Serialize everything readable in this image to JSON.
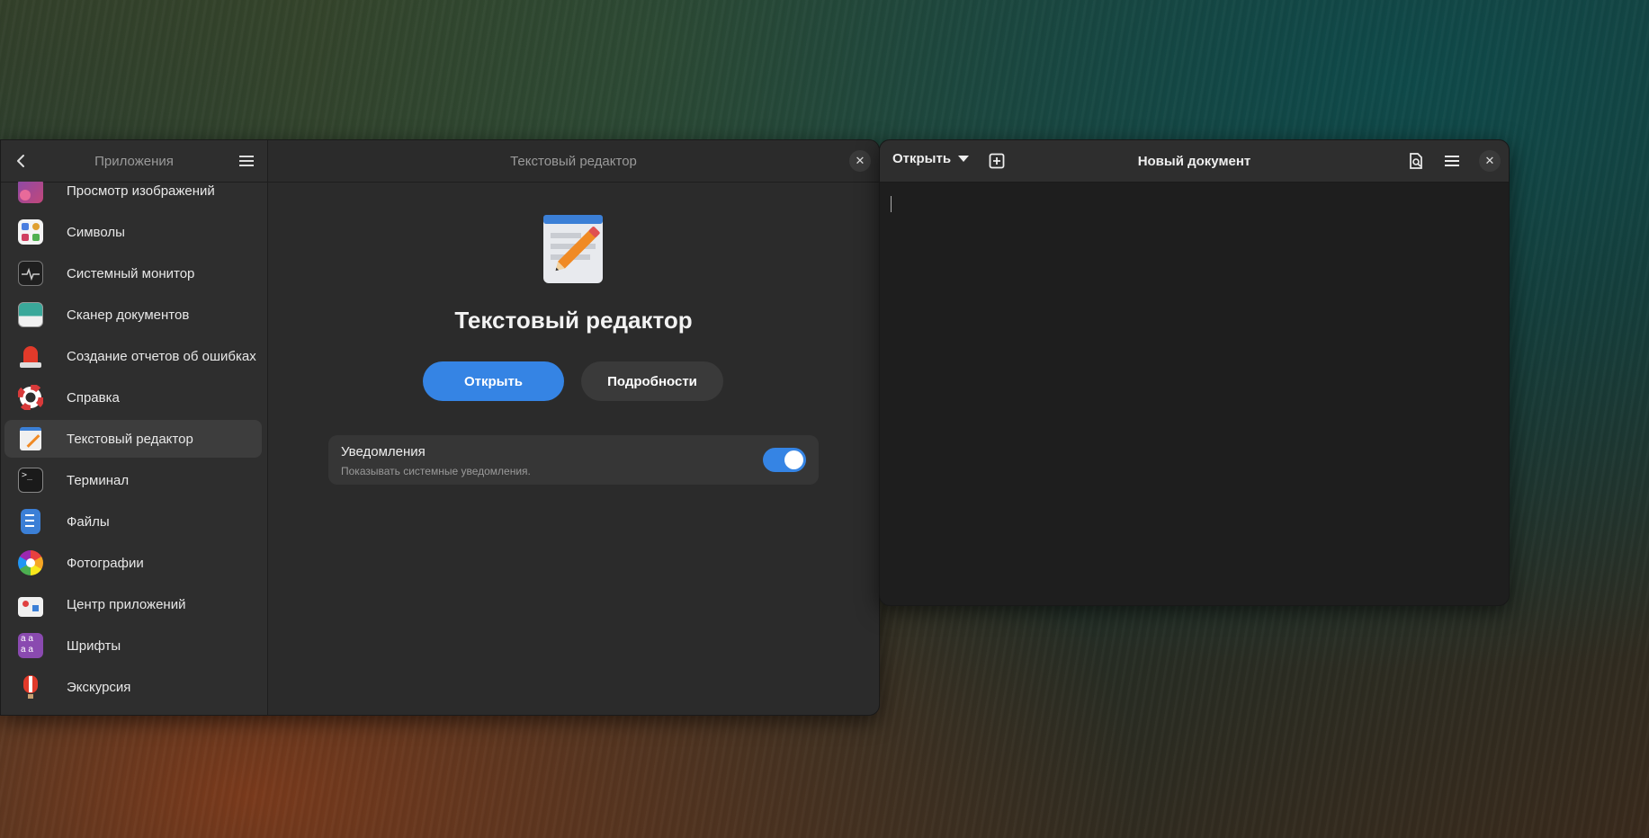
{
  "settings_window": {
    "sidebar": {
      "title": "Приложения",
      "items": [
        {
          "label": "Просмотр изображений",
          "icon": "image-viewer-icon"
        },
        {
          "label": "Символы",
          "icon": "characters-icon"
        },
        {
          "label": "Системный монитор",
          "icon": "system-monitor-icon"
        },
        {
          "label": "Сканер документов",
          "icon": "document-scanner-icon"
        },
        {
          "label": "Создание отчетов об ошибках",
          "icon": "bug-report-icon"
        },
        {
          "label": "Справка",
          "icon": "help-icon"
        },
        {
          "label": "Текстовый редактор",
          "icon": "text-editor-icon",
          "active": true
        },
        {
          "label": "Терминал",
          "icon": "terminal-icon"
        },
        {
          "label": "Файлы",
          "icon": "files-icon"
        },
        {
          "label": "Фотографии",
          "icon": "photos-icon"
        },
        {
          "label": "Центр приложений",
          "icon": "software-center-icon"
        },
        {
          "label": "Шрифты",
          "icon": "fonts-icon"
        },
        {
          "label": "Экскурсия",
          "icon": "tour-icon"
        }
      ]
    },
    "content": {
      "header_title": "Текстовый редактор",
      "app_name": "Текстовый редактор",
      "open_label": "Открыть",
      "details_label": "Подробности",
      "notifications": {
        "title": "Уведомления",
        "subtitle": "Показывать системные уведомления.",
        "enabled": true
      }
    }
  },
  "editor_window": {
    "open_label": "Открыть",
    "title": "Новый документ"
  },
  "colors": {
    "accent": "#3584e4",
    "window_bg": "#2b2b2b",
    "editor_bg": "#1e1e1e"
  }
}
